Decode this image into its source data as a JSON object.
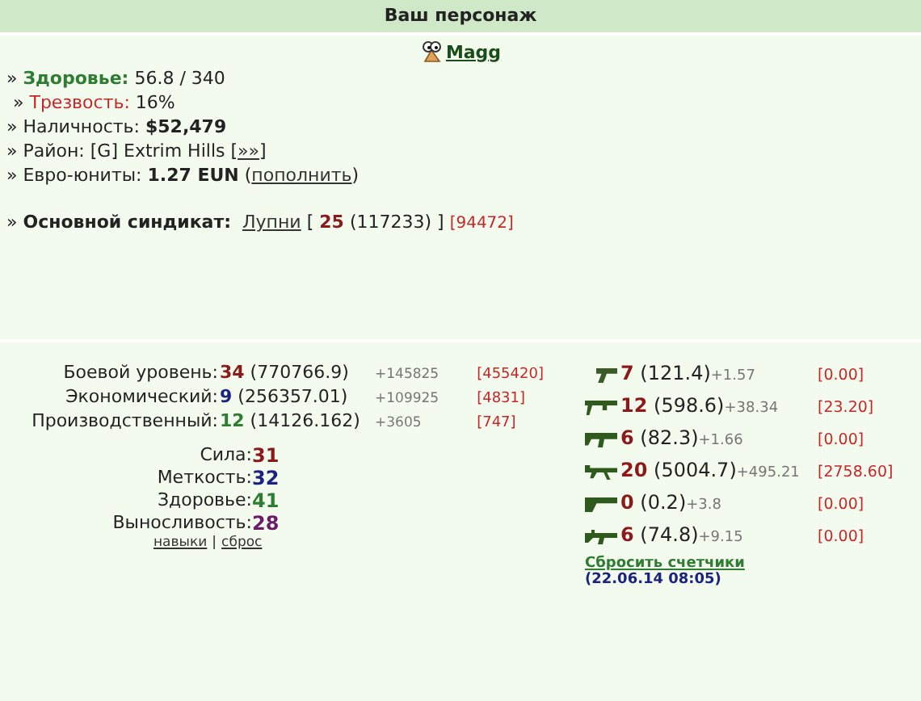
{
  "header": {
    "title": "Ваш персонаж"
  },
  "character": {
    "name": "Magg"
  },
  "info": [
    {
      "kind": "health",
      "marker": "»",
      "label": "Здоровье:",
      "value": "56.8 / 340"
    },
    {
      "kind": "sobriety",
      "marker": "»",
      "label": "Трезвость:",
      "value": "16%"
    },
    {
      "kind": "plain",
      "marker": "»",
      "label": "Наличность:",
      "value": "**$52,479**"
    },
    {
      "kind": "plain",
      "marker": "»",
      "label": "Район:",
      "value": "[G] Extrim Hills [",
      "link": "»»",
      "suffix": "]"
    },
    {
      "kind": "plain",
      "marker": "»",
      "label": "Евро-юниты:",
      "value": "**1.27 EUN** (",
      "link": "пополнить",
      "suffix": ")"
    }
  ],
  "syndicate": {
    "marker": "»",
    "label": "Основной синдикат:",
    "name": "Лупни",
    "open": "[",
    "level": "25",
    "exp": "(117233)",
    "close": "]",
    "extra": "[94472]"
  },
  "levels": [
    {
      "label": "Боевой уровень:",
      "level": "34",
      "color": "#8b1a1a",
      "exp": "(770766.9)",
      "gain": "+145825",
      "bracket": "[455420]"
    },
    {
      "label": "Экономический:",
      "level": "9",
      "color": "#1a237e",
      "exp": "(256357.01)",
      "gain": "+109925",
      "bracket": "[4831]"
    },
    {
      "label": "Производственный:",
      "level": "12",
      "color": "#2e7d32",
      "exp": "(14126.162)",
      "gain": "+3605",
      "bracket": "[747]"
    }
  ],
  "stats": [
    {
      "label": "Сила:",
      "value": "31",
      "color": "#8b1a1a"
    },
    {
      "label": "Меткость:",
      "value": "32",
      "color": "#1a237e"
    },
    {
      "label": "Здоровье:",
      "value": "41",
      "color": "#2e7d32"
    },
    {
      "label": "Выносливость:",
      "value": "28",
      "color": "#6a1b6a"
    }
  ],
  "stat_links": [
    "навыки",
    "|",
    "сброс"
  ],
  "weapons": [
    {
      "kind": "pistol",
      "level": "7",
      "exp": "(121.4)",
      "gain": "+1.57",
      "bracket": "[0.00]"
    },
    {
      "kind": "launcher",
      "level": "12",
      "exp": "(598.6)",
      "gain": "+38.34",
      "bracket": "[23.20]"
    },
    {
      "kind": "smg",
      "level": "6",
      "exp": "(82.3)",
      "gain": "+1.66",
      "bracket": "[0.00]"
    },
    {
      "kind": "machinegun",
      "level": "20",
      "exp": "(5004.7)",
      "gain": "+495.21",
      "bracket": "[2758.60]"
    },
    {
      "kind": "shotgun",
      "level": "0",
      "exp": "(0.2)",
      "gain": "+3.8",
      "bracket": "[0.00]"
    },
    {
      "kind": "rifle",
      "level": "6",
      "exp": "(74.8)",
      "gain": "+9.15",
      "bracket": "[0.00]"
    }
  ],
  "reset": {
    "link": "Сбросить счетчики",
    "date": "(22.06.14 08:05)"
  }
}
